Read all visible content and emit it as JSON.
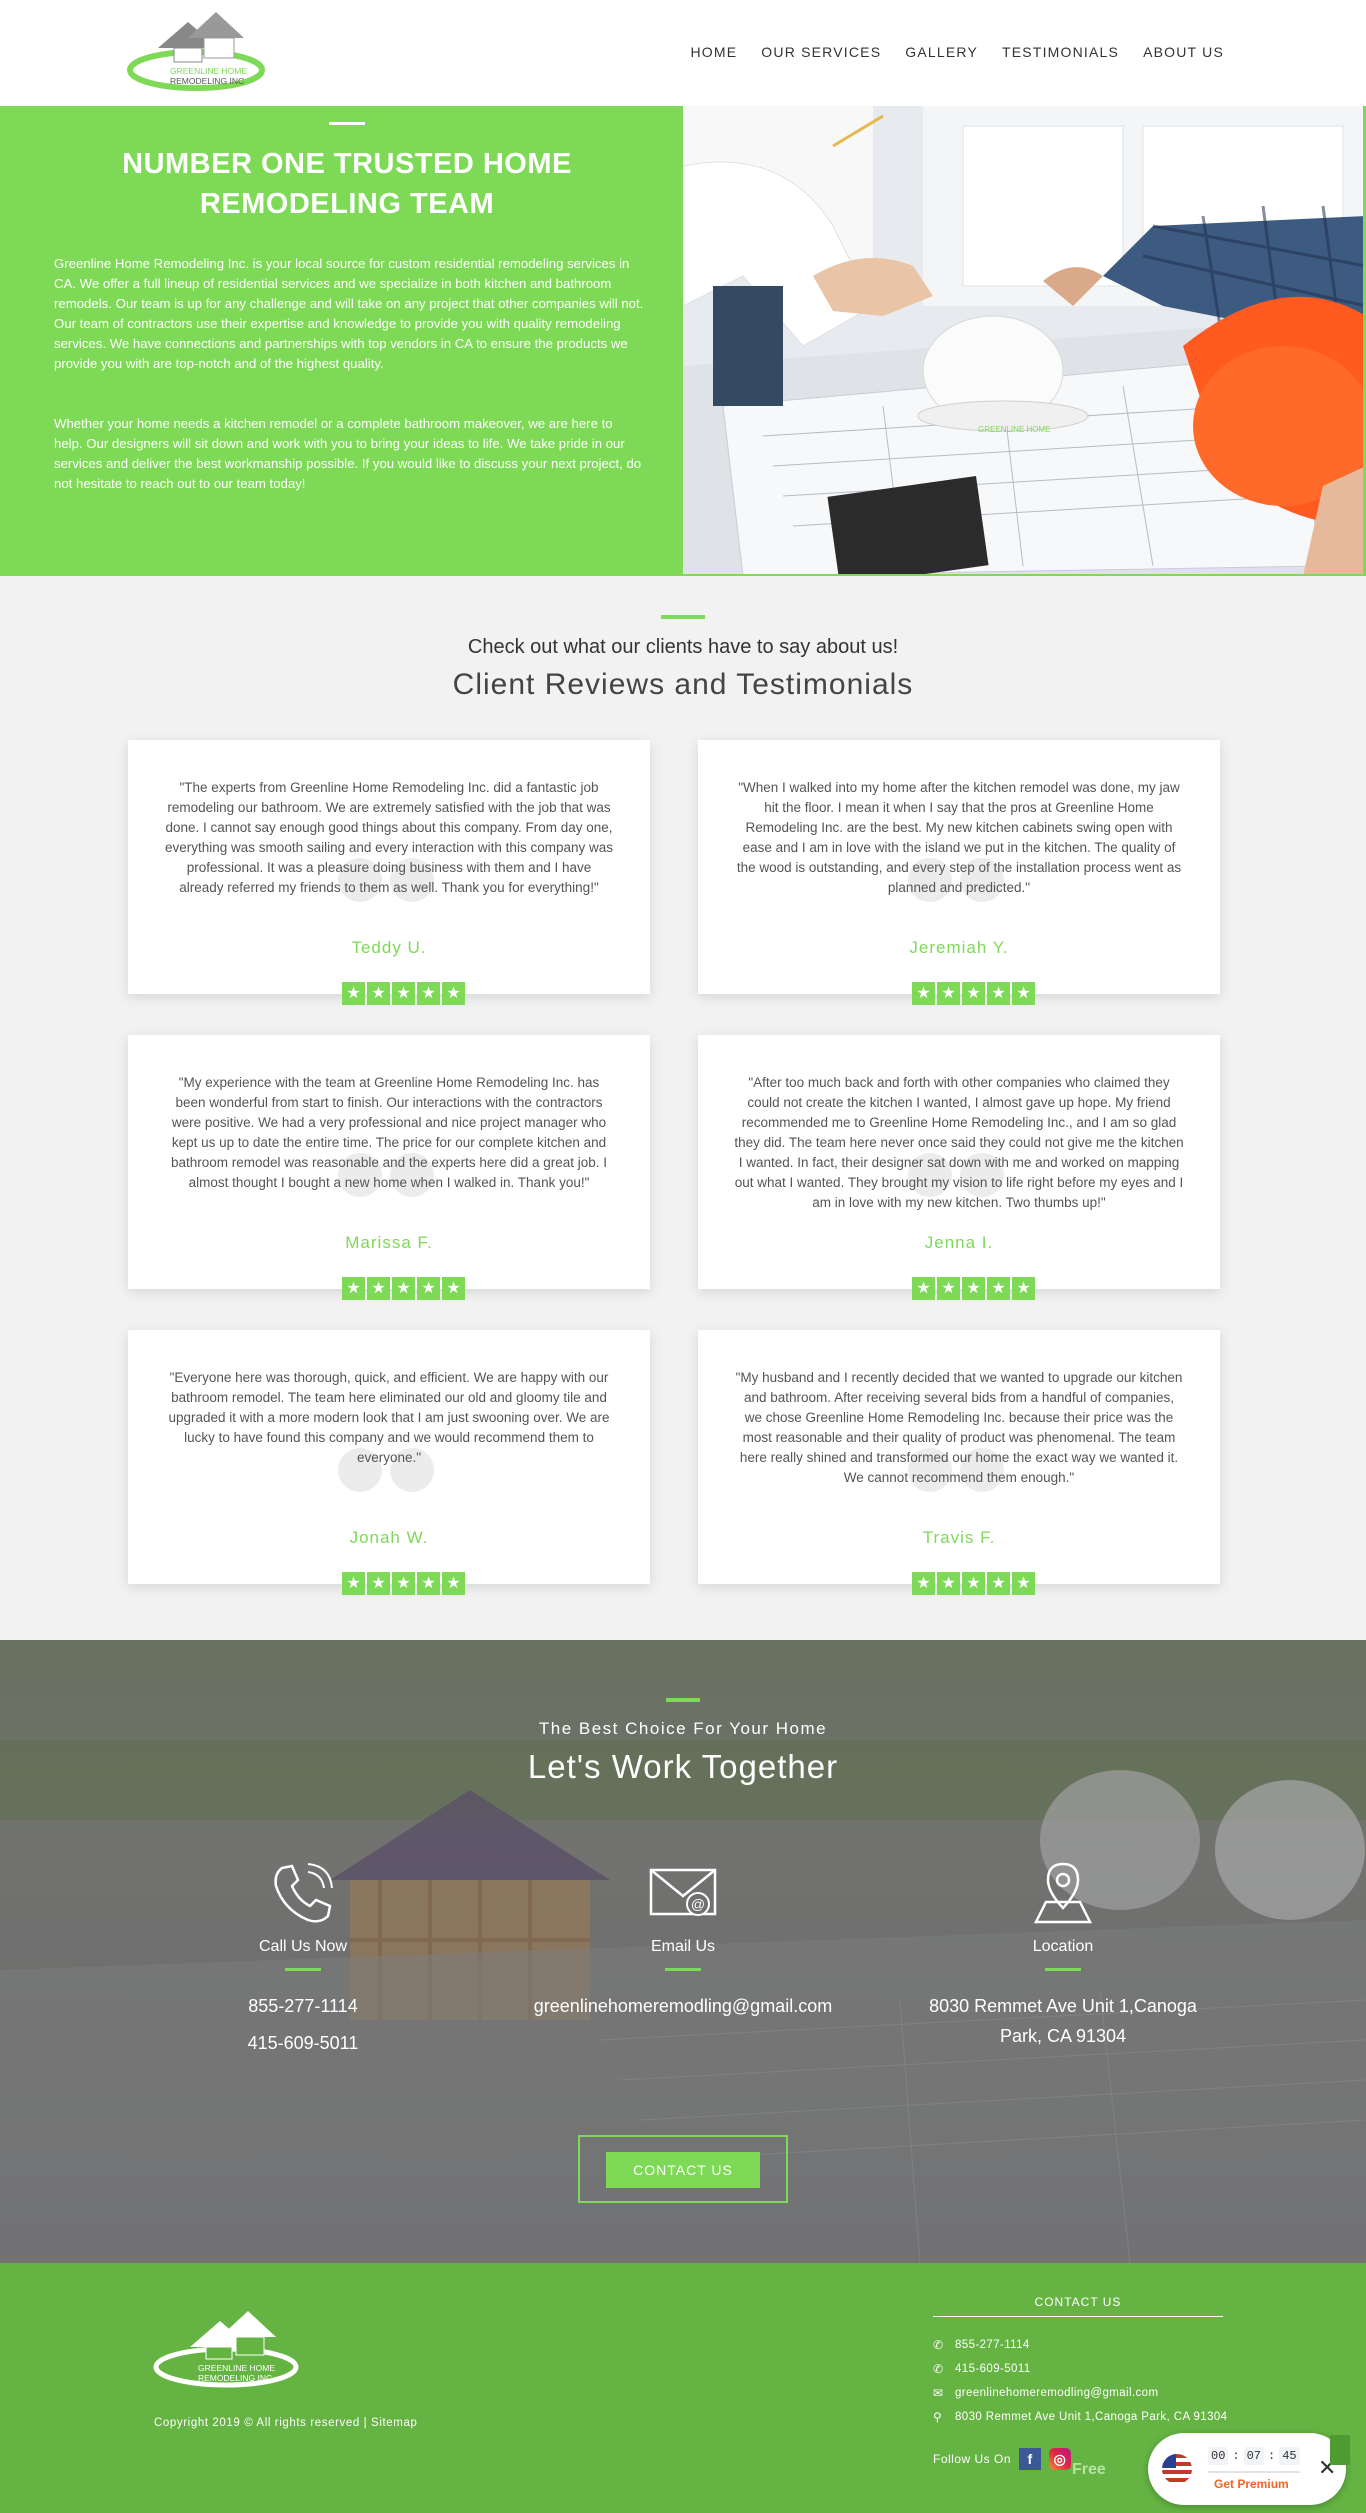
{
  "header": {
    "logo_text": "GREENLINE HOME REMODELING INC",
    "nav": [
      "HOME",
      "OUR SERVICES",
      "GALLERY",
      "TESTIMONIALS",
      "ABOUT US"
    ]
  },
  "hero": {
    "title": "NUMBER ONE TRUSTED HOME REMODELING TEAM",
    "paragraph1": "Greenline Home Remodeling Inc. is your local source for custom residential remodeling services in CA. We offer a full lineup of residential services and we specialize in both kitchen and bathroom remodels. Our team is up for any challenge and will take on any project that other companies will not. Our team of contractors use their expertise and knowledge to provide you with quality remodeling services. We have connections and partnerships with top vendors in CA to ensure the products we provide you with are top-notch and of the highest quality.",
    "paragraph2": "Whether your home needs a kitchen remodel or a complete bathroom makeover, we are here to help. Our designers will sit down and work with you to bring your ideas to life. We take pride in our services and deliver the best workmanship possible. If you would like to discuss your next project, do not hesitate to reach out to our team today!",
    "image_logo_text": "GREENLINE HOME"
  },
  "reviews": {
    "subtitle": "Check out what our clients have to say about us!",
    "title": "Client Reviews and Testimonials",
    "items": [
      {
        "text": "\"The experts from Greenline Home Remodeling Inc. did a fantastic job remodeling our bathroom. We are extremely satisfied with the job that was done. I cannot say enough good things about this company. From day one, everything was smooth sailing and every interaction with this company was professional. It was a pleasure doing business with them and I have already referred my friends to them as well. Thank you for everything!\"",
        "name": "Teddy U.",
        "stars": 5
      },
      {
        "text": "\"When I walked into my home after the kitchen remodel was done, my jaw hit the floor. I mean it when I say that the pros at Greenline Home Remodeling Inc. are the best. My new kitchen cabinets swing open with ease and I am in love with the island we put in the kitchen. The quality of the wood is outstanding, and every step of the installation process went as planned and predicted.\"",
        "name": "Jeremiah Y.",
        "stars": 5
      },
      {
        "text": "\"My experience with the team at Greenline Home Remodeling Inc. has been wonderful from start to finish. Our interactions with the contractors were positive. We had a very professional and nice project manager who kept us up to date the entire time. The price for our complete kitchen and bathroom remodel was reasonable and the experts here did a great job. I almost thought I bought a new home when I walked in. Thank you!\"",
        "name": "Marissa F.",
        "stars": 5
      },
      {
        "text": "\"After too much back and forth with other companies who claimed they could not create the kitchen I wanted, I almost gave up hope. My friend recommended me to Greenline Home Remodeling Inc., and I am so glad they did. The team here never once said they could not give me the kitchen I wanted. In fact, their designer sat down with me and worked on mapping out what I wanted. They brought my vision to life right before my eyes and I am in love with my new kitchen. Two thumbs up!\"",
        "name": "Jenna I.",
        "stars": 5
      },
      {
        "text": "\"Everyone here was thorough, quick, and efficient. We are happy with our bathroom remodel. The team here eliminated our old and gloomy tile and upgraded it with a more modern look that I am just swooning over. We are lucky to have found this company and we would recommend them to everyone.\"",
        "name": "Jonah W.",
        "stars": 5
      },
      {
        "text": "\"My husband and I recently decided that we wanted to upgrade our kitchen and bathroom. After receiving several bids from a handful of companies, we chose Greenline Home Remodeling Inc. because their price was the most reasonable and their quality of product was phenomenal. The team here really shined and transformed our home the exact way we wanted it. We cannot recommend them enough.\"",
        "name": "Travis F.",
        "stars": 5
      }
    ]
  },
  "work": {
    "subtitle": "The Best Choice For Your Home",
    "title": "Let's Work Together",
    "call_label": "Call Us Now",
    "phone1": "855-277-1114",
    "phone2": "415-609-5011",
    "email_label": "Email Us",
    "email": "greenlinehomeremodling@gmail.com",
    "location_label": "Location",
    "address": "8030 Remmet Ave Unit 1,Canoga Park, CA 91304",
    "contact_button": "CONTACT US"
  },
  "footer": {
    "copyright": "Copyright 2019 © All rights reserved | ",
    "sitemap": "Sitemap",
    "contact_title": "CONTACT US",
    "phone1": "855-277-1114",
    "phone2": "415-609-5011",
    "email": "greenlinehomeremodling@gmail.com",
    "address": "8030 Remmet Ave Unit 1,Canoga Park, CA 91304",
    "follow": "Follow Us On",
    "free_label": "Free"
  },
  "widget": {
    "hh": "00",
    "mm": "07",
    "ss": "45",
    "premium": "Get Premium"
  },
  "colors": {
    "accent": "#7ed957",
    "footer_bg": "#65b443",
    "premium": "#f26522"
  }
}
